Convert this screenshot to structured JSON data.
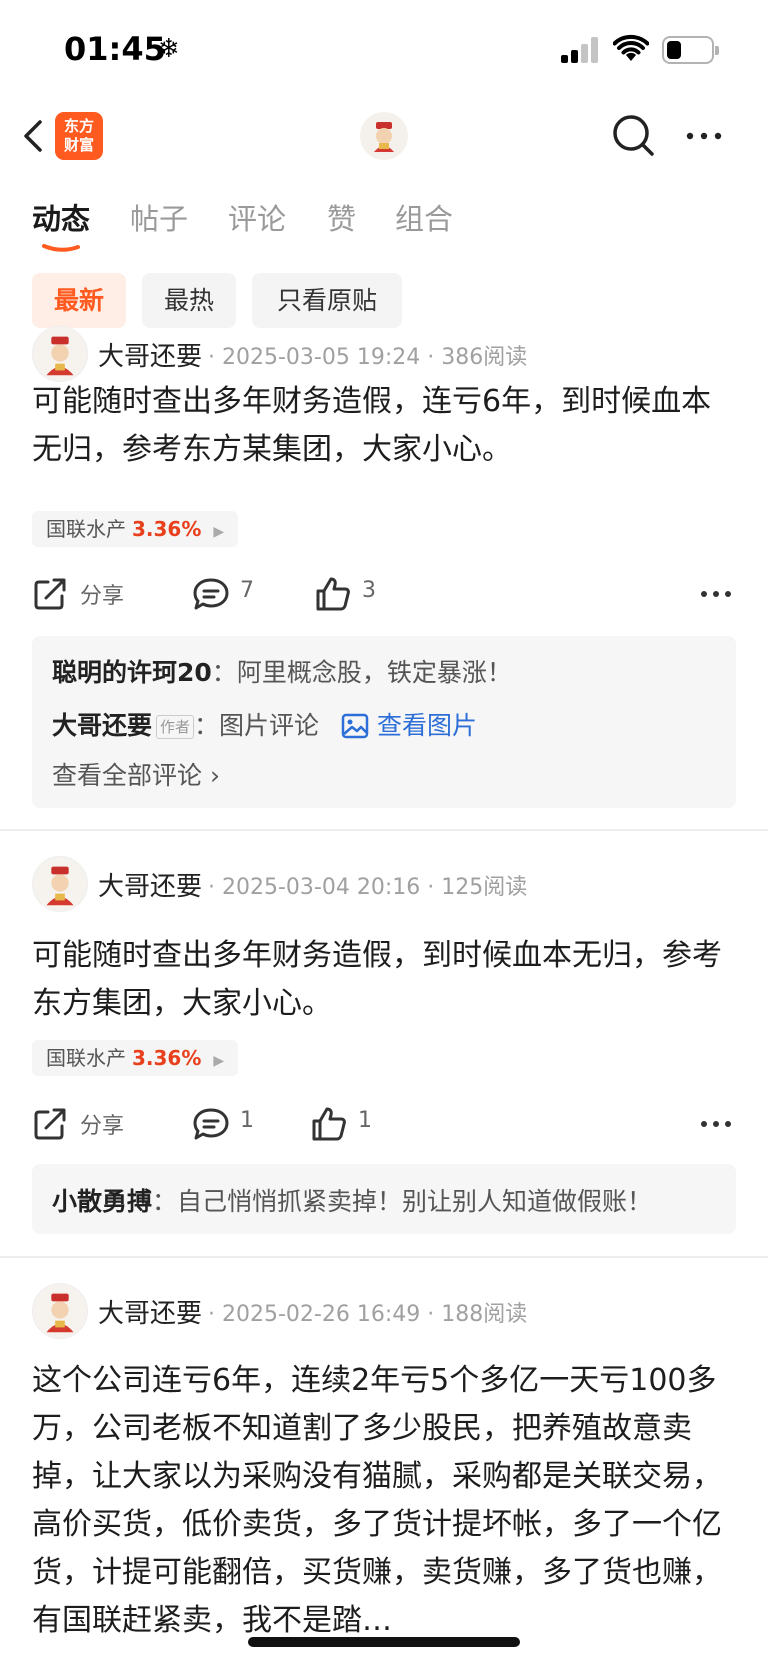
{
  "status_bar": {
    "time": "01:45",
    "time_icon": "snowflake-icon"
  },
  "header": {
    "logo_text_line1": "东方",
    "logo_text_line2": "财富",
    "brand_color": "#ff5a1f"
  },
  "tabs": [
    {
      "label": "动态",
      "active": true
    },
    {
      "label": "帖子",
      "active": false
    },
    {
      "label": "评论",
      "active": false
    },
    {
      "label": "赞",
      "active": false
    },
    {
      "label": "组合",
      "active": false
    }
  ],
  "filters": [
    {
      "label": "最新",
      "active": true
    },
    {
      "label": "最热",
      "active": false
    },
    {
      "label": "只看原贴",
      "active": false
    }
  ],
  "posts": [
    {
      "author": "大哥还要",
      "meta": "· 2025-03-05 19:24 · 386阅读",
      "text": "可能随时查出多年财务造假，连亏6年，到时候血本无归，参考东方某集团，大家小心。",
      "stock": {
        "name": "国联水产",
        "pct": "3.36%",
        "arrow": "▶"
      },
      "share_label": "分享",
      "comments": "7",
      "likes": "3",
      "replies": [
        {
          "who": "聪明的许珂20",
          "sep": "：",
          "text": "阿里概念股，铁定暴涨！"
        },
        {
          "who": "大哥还要",
          "badge": "作者",
          "sep": "：",
          "text": "图片评论",
          "link": "查看图片"
        }
      ],
      "view_all": "查看全部评论 ›"
    },
    {
      "author": "大哥还要",
      "meta": "· 2025-03-04 20:16 · 125阅读",
      "text": "可能随时查出多年财务造假，到时候血本无归，参考东方集团，大家小心。",
      "stock": {
        "name": "国联水产",
        "pct": "3.36%",
        "arrow": "▶"
      },
      "share_label": "分享",
      "comments": "1",
      "likes": "1",
      "replies": [
        {
          "who": "小散勇搏",
          "sep": "：",
          "text": "自己悄悄抓紧卖掉！别让别人知道做假账！"
        }
      ]
    },
    {
      "author": "大哥还要",
      "meta": "· 2025-02-26 16:49 · 188阅读",
      "text": "这个公司连亏6年，连续2年亏5个多亿一天亏100多万，公司老板不知道割了多少股民，把养殖故意卖掉，让大家以为采购没有猫腻，采购都是关联交易，高价买货，低价卖货，多了货计提坏帐，多了一个亿货，计提可能翻倍，买货赚，卖货赚，多了货也赚，有国联赶紧卖，我不是踏…"
    }
  ]
}
